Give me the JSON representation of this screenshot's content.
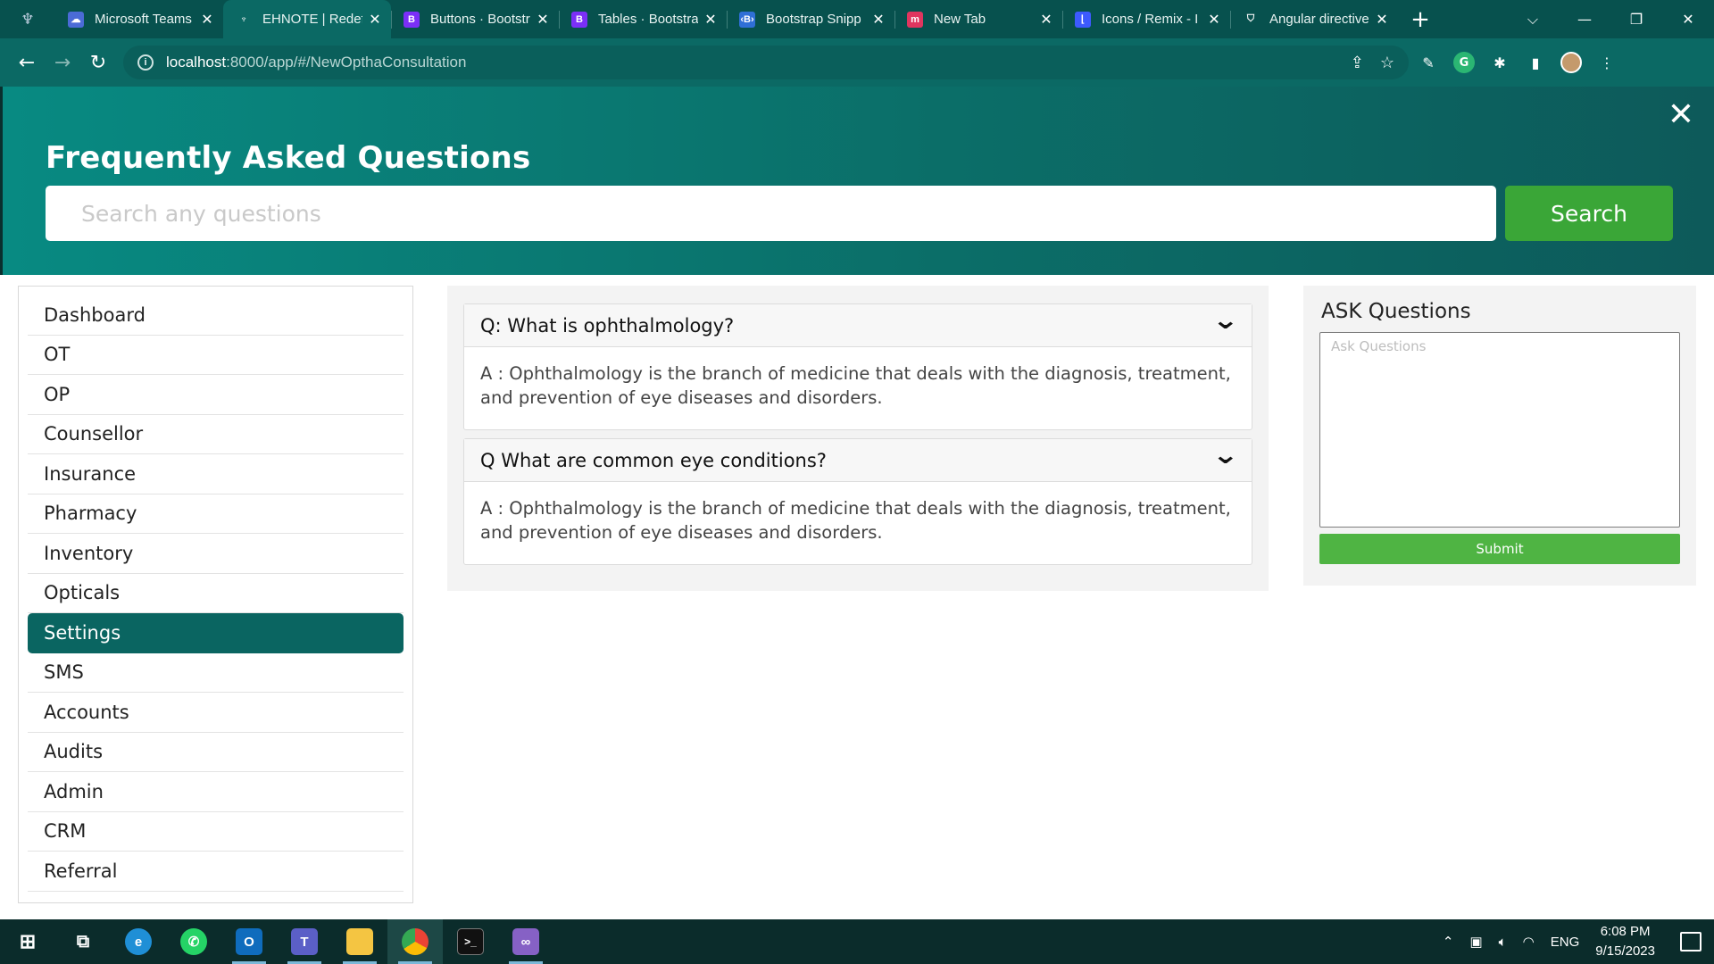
{
  "browser": {
    "tabs": [
      {
        "title": "Microsoft Teams",
        "icon": "teams-icon",
        "color": "#4b6bd6",
        "glyph": "☁"
      },
      {
        "title": "EHNOTE | Redefi",
        "icon": "ehnote-icon",
        "color": "transparent",
        "glyph": "♆",
        "active": true
      },
      {
        "title": "Buttons · Bootstr",
        "icon": "bootstrap-icon",
        "color": "#7b2ff7",
        "glyph": "B"
      },
      {
        "title": "Tables · Bootstra",
        "icon": "bootstrap-icon",
        "color": "#7b2ff7",
        "glyph": "B"
      },
      {
        "title": "Bootstrap Snipp",
        "icon": "snippets-icon",
        "color": "#2f6fd6",
        "glyph": "‹B›"
      },
      {
        "title": "New Tab",
        "icon": "newtab-icon",
        "color": "#e0355f",
        "glyph": "m"
      },
      {
        "title": "Icons / Remix - I",
        "icon": "remix-icon",
        "color": "#3d5afe",
        "glyph": "⌊"
      },
      {
        "title": "Angular directive",
        "icon": "angular-icon",
        "color": "transparent",
        "glyph": "⛉"
      }
    ],
    "url_host": "localhost",
    "url_path": ":8000/app/#/NewOpthaConsultation"
  },
  "header": {
    "title": "Frequently Asked Questions",
    "search_placeholder": "Search any questions",
    "search_label": "Search"
  },
  "sidebar": {
    "items": [
      "Dashboard",
      "OT",
      "OP",
      "Counsellor",
      "Insurance",
      "Pharmacy",
      "Inventory",
      "Opticals",
      "Settings",
      "SMS",
      "Accounts",
      "Audits",
      "Admin",
      "CRM",
      "Referral"
    ],
    "active": "Settings"
  },
  "faq": [
    {
      "question": "Q: What is ophthalmology?",
      "answer": "A : Ophthalmology is the branch of medicine that deals with the diagnosis, treatment, and prevention of eye diseases and disorders."
    },
    {
      "question": "Q What are common eye conditions?",
      "answer": "A : Ophthalmology is the branch of medicine that deals with the diagnosis, treatment, and prevention of eye diseases and disorders."
    }
  ],
  "ask": {
    "title": "ASK Questions",
    "placeholder": "Ask Questions",
    "submit_label": "Submit"
  },
  "taskbar": {
    "language": "ENG",
    "time": "6:08 PM",
    "date": "9/15/2023"
  },
  "colors": {
    "header_start": "#088a82",
    "header_end": "#0d5a5a",
    "accent_green": "#3aa637",
    "active_nav": "#0a6561"
  }
}
